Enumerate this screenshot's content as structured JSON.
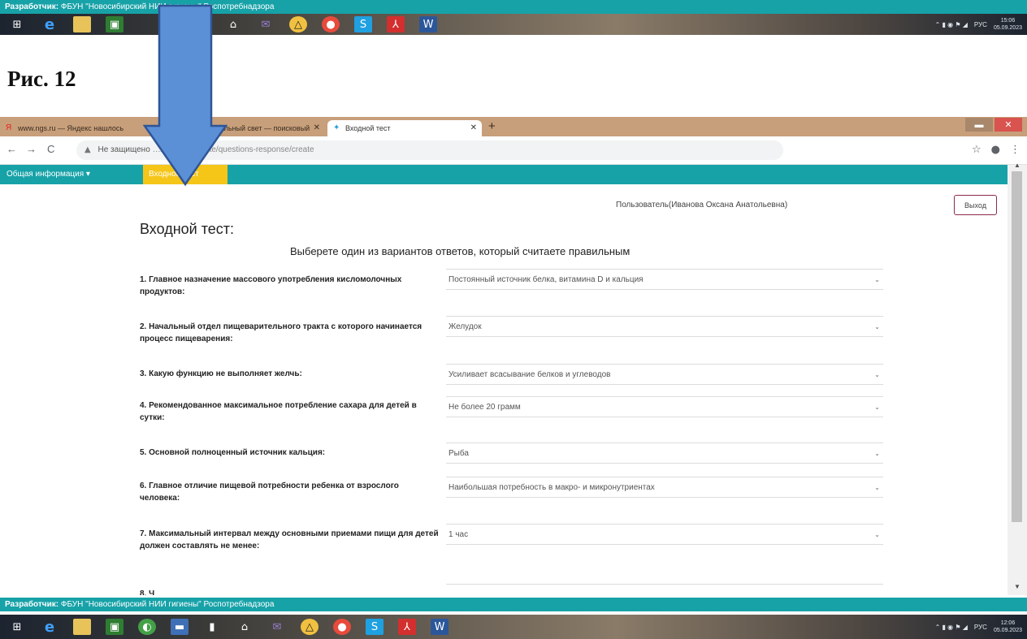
{
  "top_strip": {
    "label": "Разработчик:",
    "text": "ФБУН \"Новосибирский НИИ гигиены\" Роспотребнадзора"
  },
  "bottom_strip": {
    "label": "Разработчик:",
    "text": "ФБУН \"Новосибирский НИИ гигиены\" Роспотребнадзора"
  },
  "taskbar": {
    "icons": [
      "windows-start-icon",
      "ie-icon",
      "folder-icon",
      "store-icon",
      "monitor-icon",
      "document-icon",
      "home-icon",
      "mail-icon",
      "triangle-app-icon",
      "chrome-icon",
      "skype-icon",
      "pdf-icon",
      "word-icon"
    ],
    "tray_lang": "РУС",
    "top_clock": {
      "time": "15:06",
      "date": "05.09.2023"
    },
    "bottom_clock": {
      "time": "12:06",
      "date": "05.09.2023"
    }
  },
  "caption": "Рис. 12",
  "browser": {
    "tabs": [
      {
        "title": "www.ngs.ru — Яндекс нашлось",
        "favicon": "yandex-icon"
      },
      {
        "title": "Специальный свет — поисковый",
        "favicon": "yandex-icon"
      },
      {
        "title": "Входной тест",
        "favicon": "site-icon"
      }
    ],
    "new_tab": "+",
    "address": {
      "security": "Не защищено",
      "url": "…/otomarphy/site/questions-response/create"
    },
    "nav": {
      "back": "←",
      "forward": "→",
      "reload": "C"
    },
    "app_menu": [
      {
        "label": "Общая информация ▾"
      },
      {
        "label": "Входной тест"
      }
    ],
    "user_line": "Пользователь(Иванова Оксана Анатольевна)",
    "logout_label": "Выход",
    "page_title": "Входной тест:",
    "instruction": "Выберете один из вариантов ответов, который считаете правильным",
    "questions": [
      {
        "label": "1. Главное назначение массового употребления кисломолочных продуктов:",
        "answer": "Постоянный источник белка, витамина D и кальция"
      },
      {
        "label": "2. Начальный отдел пищеварительного тракта с которого начинается процесс пищеварения:",
        "answer": "Желудок"
      },
      {
        "label": "3. Какую функцию не выполняет желчь:",
        "answer": "Усиливает всасывание белков и углеводов"
      },
      {
        "label": "4. Рекомендованное максимальное потребление сахара для детей в сутки:",
        "answer": "Не более 20 грамм"
      },
      {
        "label": "5. Основной полноценный источник кальция:",
        "answer": "Рыба"
      },
      {
        "label": "6. Главное отличие пищевой потребности ребенка от взрослого человека:",
        "answer": "Наибольшая потребность в макро- и микронутриентах"
      },
      {
        "label": "7. Максимальный интервал между основными приемами пищи для детей должен составлять не менее:",
        "answer": "1 час"
      },
      {
        "label": "8. Ч",
        "answer": ""
      }
    ]
  },
  "colors": {
    "teal": "#17a2a8",
    "active_menu": "#f5c518",
    "arrow_fill": "#5b8fd6",
    "arrow_stroke": "#2f5597",
    "tabbar": "#c79f7a"
  }
}
